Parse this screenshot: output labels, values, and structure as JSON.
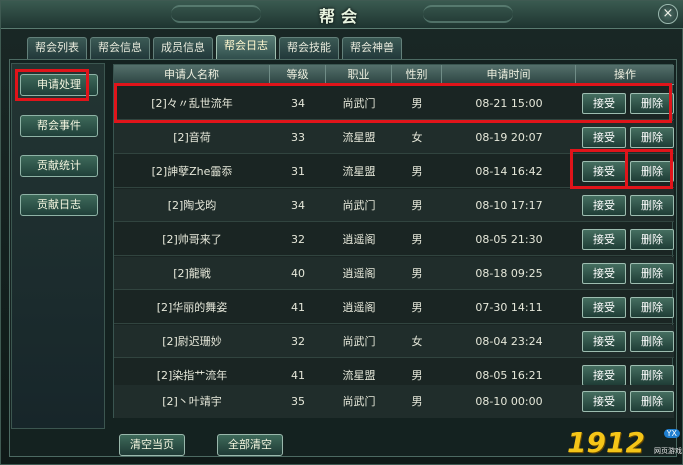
{
  "window": {
    "title": "帮会",
    "close_glyph": "×"
  },
  "tabs": [
    {
      "label": "帮会列表",
      "active": false
    },
    {
      "label": "帮会信息",
      "active": false
    },
    {
      "label": "成员信息",
      "active": false
    },
    {
      "label": "帮会日志",
      "active": true
    },
    {
      "label": "帮会技能",
      "active": false
    },
    {
      "label": "帮会神兽",
      "active": false
    }
  ],
  "sidebar": {
    "items": [
      {
        "label": "申请处理",
        "selected": true
      },
      {
        "label": "帮会事件",
        "selected": false
      },
      {
        "label": "贡献统计",
        "selected": false
      },
      {
        "label": "贡献日志",
        "selected": false
      }
    ]
  },
  "table": {
    "headers": [
      "申请人名称",
      "等级",
      "职业",
      "性别",
      "申请时间",
      "操作"
    ],
    "accept_label": "接受",
    "delete_label": "删除",
    "rows": [
      {
        "name": "[2]々〃乱世流年",
        "level": "34",
        "class": "尚武门",
        "gender": "男",
        "time": "08-21 15:00"
      },
      {
        "name": "[2]音荷",
        "level": "33",
        "class": "流星盟",
        "gender": "女",
        "time": "08-19 20:07"
      },
      {
        "name": "[2]訷孽Zhe霝忝",
        "level": "31",
        "class": "流星盟",
        "gender": "男",
        "time": "08-14 16:42"
      },
      {
        "name": "[2]陶戈昀",
        "level": "34",
        "class": "尚武门",
        "gender": "男",
        "time": "08-10 17:17"
      },
      {
        "name": "[2]帅哥来了",
        "level": "32",
        "class": "逍遥阁",
        "gender": "男",
        "time": "08-05 21:30"
      },
      {
        "name": "[2]龍戦",
        "level": "40",
        "class": "逍遥阁",
        "gender": "男",
        "time": "08-18 09:25"
      },
      {
        "name": "[2]华丽的舞姿",
        "level": "41",
        "class": "逍遥阁",
        "gender": "男",
        "time": "07-30 14:11"
      },
      {
        "name": "[2]尉迟珊妙",
        "level": "32",
        "class": "尚武门",
        "gender": "女",
        "time": "08-04 23:24"
      },
      {
        "name": "[2]染指艹流年",
        "level": "41",
        "class": "流星盟",
        "gender": "男",
        "time": "08-05 16:21"
      },
      {
        "name": "[2]丶叶靖宇",
        "level": "35",
        "class": "尚武门",
        "gender": "男",
        "time": "08-10 00:00"
      }
    ]
  },
  "footer": {
    "clear_page_label": "清空当页",
    "clear_all_label": "全部清空"
  },
  "watermark": {
    "number": "1912",
    "badge": "YX",
    "subtitle": "网页游戏"
  },
  "colors": {
    "highlight": "#e0141a",
    "accent_text": "#fff8d0",
    "watermark": "#f5c518"
  }
}
